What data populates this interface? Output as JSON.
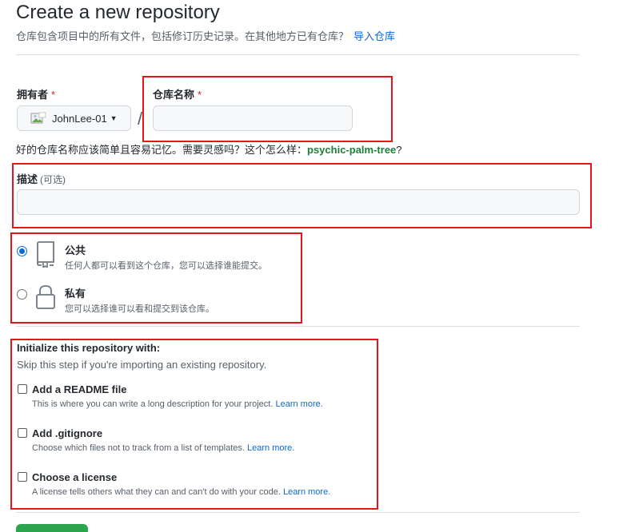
{
  "header": {
    "title": "Create a new repository",
    "subtitle": "仓库包含项目中的所有文件，包括修订历史记录。在其他地方已有仓库？",
    "import_link": "导入仓库"
  },
  "owner": {
    "label": "拥有者",
    "required_mark": "*",
    "selected": "JohnLee-01"
  },
  "repo_name": {
    "label": "仓库名称",
    "required_mark": "*",
    "value": "",
    "separator": "/"
  },
  "name_hint": {
    "text": "好的仓库名称应该简单且容易记忆。需要灵感吗？这个怎么样：",
    "suggestion": "psychic-palm-tree",
    "suffix": "?"
  },
  "description": {
    "label": "描述",
    "optional": "(可选)",
    "value": ""
  },
  "visibility": {
    "selected": "public",
    "options": [
      {
        "title": "公共",
        "desc": "任何人都可以看到这个仓库，您可以选择谁能提交。"
      },
      {
        "title": "私有",
        "desc": "您可以选择谁可以看和提交到该仓库。"
      }
    ]
  },
  "init": {
    "title": "Initialize this repository with:",
    "subtitle": "Skip this step if you're importing an existing repository.",
    "options": [
      {
        "title": "Add a README file",
        "desc": "This is where you can write a long description for your project.",
        "link": "Learn more.",
        "checked": false
      },
      {
        "title": "Add .gitignore",
        "desc": "Choose which files not to track from a list of templates.",
        "link": "Learn more.",
        "checked": false
      },
      {
        "title": "Choose a license",
        "desc": "A license tells others what they can and can't do with your code.",
        "link": "Learn more.",
        "checked": false
      }
    ]
  },
  "colors": {
    "accent": "#0969da",
    "highlight_border": "#e5151b",
    "suggestion": "#1a7f37",
    "create_button": "#2da44e"
  }
}
